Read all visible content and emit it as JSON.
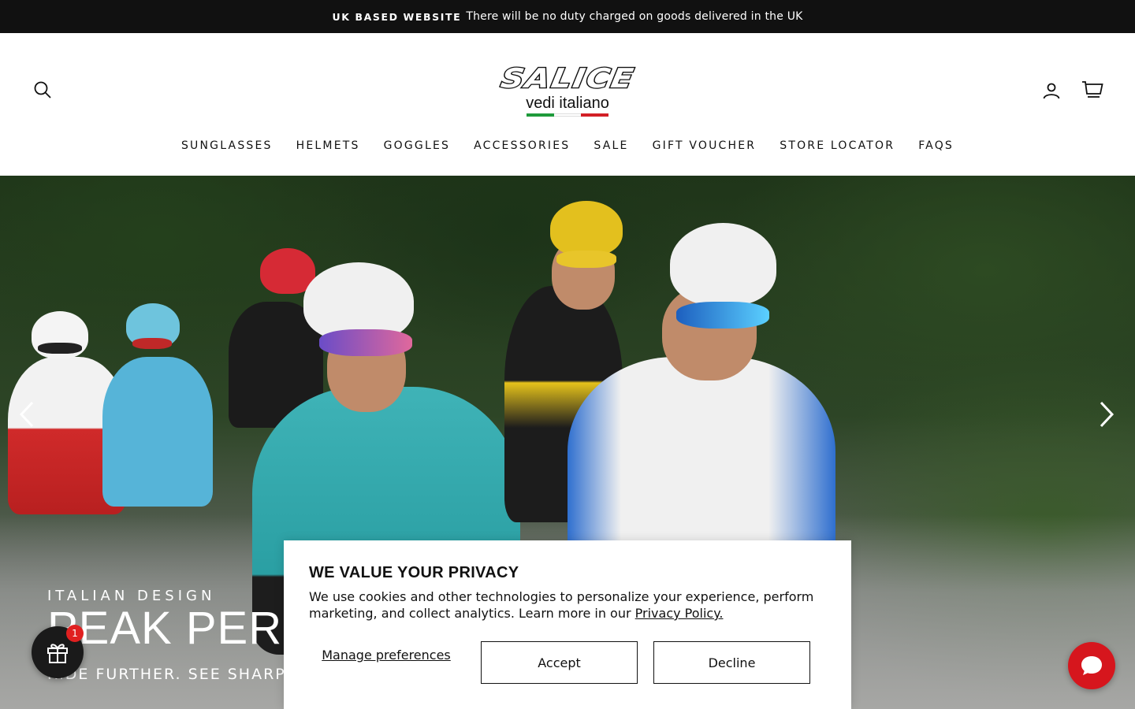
{
  "announcement": {
    "strong": "UK BASED WEBSITE",
    "text": "There will be no duty charged on goods delivered in the UK"
  },
  "header": {
    "logo_wordmark": "SALICE",
    "logo_tagline": "vedi italiano",
    "search_icon": "search-icon",
    "account_icon": "account-icon",
    "cart_icon": "cart-icon",
    "nav": [
      {
        "label": "SUNGLASSES"
      },
      {
        "label": "HELMETS"
      },
      {
        "label": "GOGGLES"
      },
      {
        "label": "ACCESSORIES"
      },
      {
        "label": "SALE"
      },
      {
        "label": "GIFT VOUCHER"
      },
      {
        "label": "STORE LOCATOR"
      },
      {
        "label": "FAQS"
      }
    ]
  },
  "hero": {
    "kicker": "ITALIAN DESIGN",
    "title": "PEAK PERF",
    "subtitle": "RIDE FURTHER. SEE SHARPER",
    "prev_icon": "chevron-left-icon",
    "next_icon": "chevron-right-icon"
  },
  "rewards": {
    "icon": "gift-icon",
    "badge": "1"
  },
  "cookie": {
    "title": "WE VALUE YOUR PRIVACY",
    "body": "We use cookies and other technologies to personalize your experience, perform marketing, and collect analytics. Learn more in our",
    "link": "Privacy Policy.",
    "manage": "Manage preferences",
    "accept": "Accept",
    "decline": "Decline"
  },
  "chat": {
    "icon": "chat-bubble-icon"
  },
  "colors": {
    "announcement_bg": "#111111",
    "chat_red": "#d6161d",
    "badge_red": "#e02020",
    "flag_green": "#1e9a3b",
    "flag_red": "#d21f26"
  }
}
